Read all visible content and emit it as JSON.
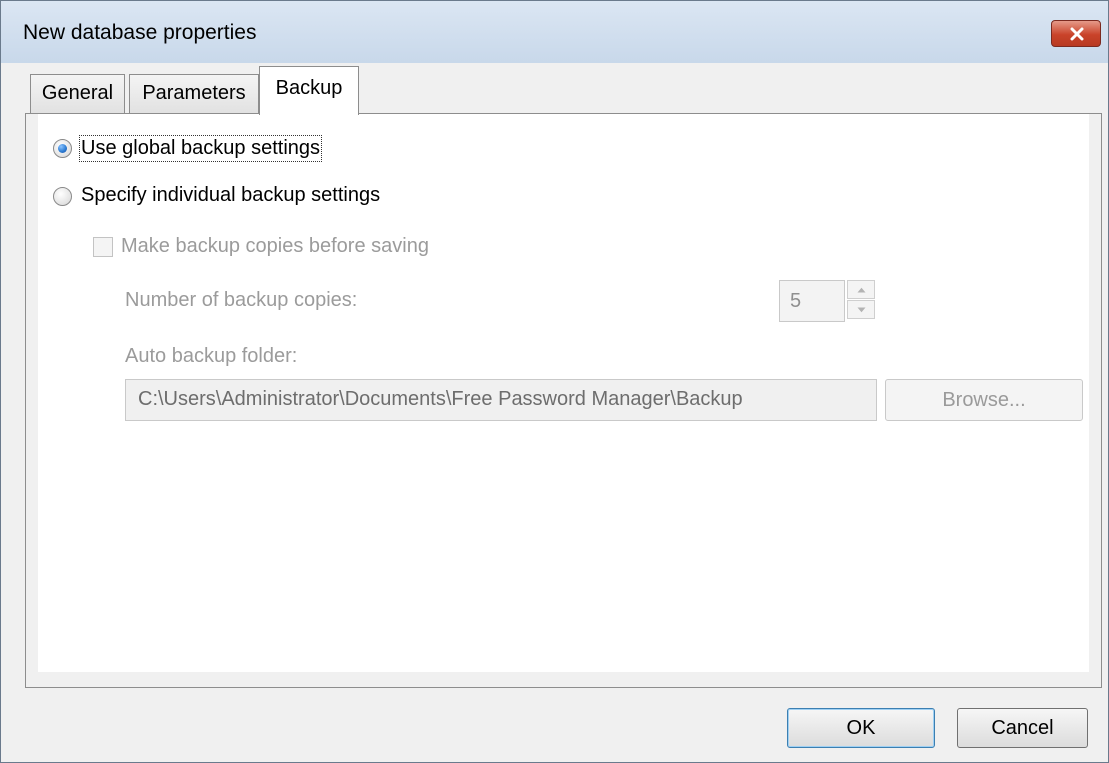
{
  "window": {
    "title": "New database properties"
  },
  "tabs": [
    {
      "label": "General",
      "selected": false
    },
    {
      "label": "Parameters",
      "selected": false
    },
    {
      "label": "Backup",
      "selected": true
    }
  ],
  "backup": {
    "use_global_label": "Use global backup settings",
    "use_global_checked": true,
    "specify_individual_label": "Specify individual backup settings",
    "specify_individual_checked": false,
    "make_copies_label": "Make backup copies before saving",
    "make_copies_checked": false,
    "number_of_copies_label": "Number of backup copies:",
    "number_of_copies_value": "5",
    "folder_label": "Auto backup folder:",
    "folder_value": "C:\\Users\\Administrator\\Documents\\Free Password Manager\\Backup",
    "browse_label": "Browse..."
  },
  "buttons": {
    "ok_label": "OK",
    "cancel_label": "Cancel"
  },
  "colors": {
    "close_button": "#c9432a",
    "titlebar": "#c8d8ea",
    "radio_selected": "#2f7fd6",
    "disabled_text": "#9b9b9b"
  },
  "icons": {
    "close": "close-icon",
    "spin_up": "spin-up-icon",
    "spin_down": "spin-down-icon"
  }
}
